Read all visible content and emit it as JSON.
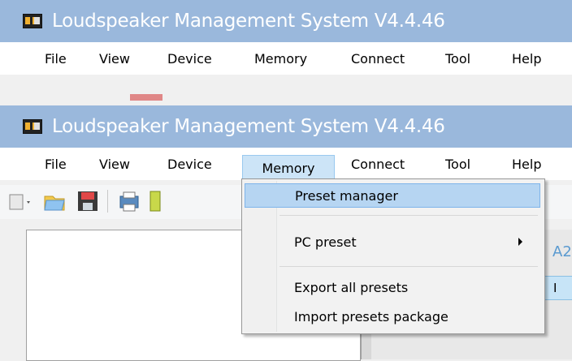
{
  "window_back": {
    "title": "Loudspeaker Management System V4.4.46",
    "menu": [
      "File",
      "View",
      "Device",
      "Memory",
      "Connect",
      "Tool",
      "Help"
    ]
  },
  "window_front": {
    "title": "Loudspeaker Management System V4.4.46",
    "menu": [
      "File",
      "View",
      "Device",
      "Memory",
      "Connect",
      "Tool",
      "Help"
    ],
    "active_menu": "Memory"
  },
  "toolbar": {
    "icons": [
      "new-icon",
      "open-folder-icon",
      "save-icon",
      "print-icon",
      "device-icon"
    ]
  },
  "memory_menu": {
    "items": [
      {
        "label": "Preset manager",
        "highlighted": true
      },
      {
        "label": "PC preset",
        "submenu": true
      },
      {
        "label": "Export all presets"
      },
      {
        "label": "Import presets package"
      }
    ]
  },
  "peek": {
    "label_fragment": "A2",
    "tab_fragment": "I"
  },
  "colors": {
    "titlebar": "#9ab8dc",
    "menu_highlight": "#cce4f7",
    "dropdown_highlight": "#b6d5f2"
  }
}
